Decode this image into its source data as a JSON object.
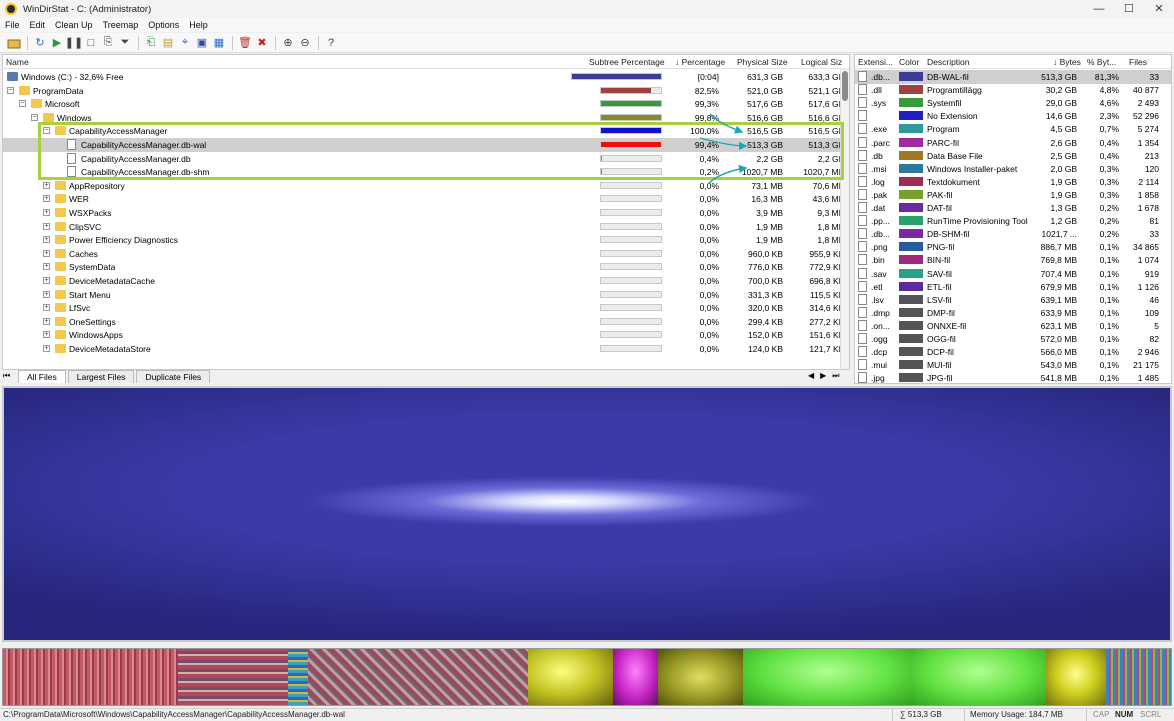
{
  "window": {
    "title": "WinDirStat - C: (Administrator)",
    "minimize": "—",
    "maximize": "☐",
    "close": "✕"
  },
  "menu": [
    "File",
    "Edit",
    "Clean Up",
    "Treemap",
    "Options",
    "Help"
  ],
  "tree": {
    "columns": {
      "name": "Name",
      "subtree": "Subtree Percentage",
      "percentage": "↓ Percentage",
      "physical": "Physical Size",
      "logical": "Logical Siz"
    },
    "rows": [
      {
        "name": "Windows (C:) - 32,6% Free",
        "level": 0,
        "kind": "drive",
        "exp": "",
        "bar": 1.0,
        "color": "#3b3b9c",
        "pct": "[0:04]",
        "phys": "631,3 GB",
        "log": "633,3 GI"
      },
      {
        "name": "ProgramData",
        "level": 0,
        "kind": "folder",
        "exp": "−",
        "bar": 0.825,
        "color": "#a04040",
        "pct": "82,5%",
        "phys": "521,0 GB",
        "log": "521,1 GI"
      },
      {
        "name": "Microsoft",
        "level": 1,
        "kind": "folder",
        "exp": "−",
        "bar": 0.993,
        "color": "#3a9a3a",
        "pct": "99,3%",
        "phys": "517,6 GB",
        "log": "517,6 GI"
      },
      {
        "name": "Windows",
        "level": 2,
        "kind": "folder",
        "exp": "−",
        "bar": 0.998,
        "color": "#8a8a2a",
        "pct": "99,8%",
        "phys": "516,6 GB",
        "log": "516,6 GI"
      },
      {
        "name": "CapabilityAccessManager",
        "level": 3,
        "kind": "folder",
        "exp": "−",
        "bar": 1.0,
        "color": "#1010d0",
        "pct": "100,0%",
        "phys": "516,5 GB",
        "log": "516,5 GI"
      },
      {
        "name": "CapabilityAccessManager.db-wal",
        "level": 4,
        "kind": "file",
        "exp": "",
        "bar": 0.994,
        "color": "#ee1010",
        "pct": "99,4%",
        "phys": "513,3 GB",
        "log": "513,3 GI",
        "selected": true
      },
      {
        "name": "CapabilityAccessManager.db",
        "level": 4,
        "kind": "file",
        "exp": "",
        "bar": 0.004,
        "color": "#888888",
        "pct": "0,4%",
        "phys": "2,2 GB",
        "log": "2,2 GI"
      },
      {
        "name": "CapabilityAccessManager.db-shm",
        "level": 4,
        "kind": "file",
        "exp": "",
        "bar": 0.002,
        "color": "#888888",
        "pct": "0,2%",
        "phys": "1020,7 MB",
        "log": "1020,7 MI"
      },
      {
        "name": "AppRepository",
        "level": 3,
        "kind": "folder",
        "exp": "+",
        "bar": 0.0,
        "color": "#888888",
        "pct": "0,0%",
        "phys": "73,1 MB",
        "log": "70,6 MI"
      },
      {
        "name": "WER",
        "level": 3,
        "kind": "folder",
        "exp": "+",
        "bar": 0.0,
        "color": "#888888",
        "pct": "0,0%",
        "phys": "16,3 MB",
        "log": "43,6 MI"
      },
      {
        "name": "WSXPacks",
        "level": 3,
        "kind": "folder",
        "exp": "+",
        "bar": 0.0,
        "color": "#888888",
        "pct": "0,0%",
        "phys": "3,9 MB",
        "log": "9,3 MI"
      },
      {
        "name": "ClipSVC",
        "level": 3,
        "kind": "folder",
        "exp": "+",
        "bar": 0.0,
        "color": "#888888",
        "pct": "0,0%",
        "phys": "1,9 MB",
        "log": "1,8 MI"
      },
      {
        "name": "Power Efficiency Diagnostics",
        "level": 3,
        "kind": "folder",
        "exp": "+",
        "bar": 0.0,
        "color": "#888888",
        "pct": "0,0%",
        "phys": "1,9 MB",
        "log": "1,8 MI"
      },
      {
        "name": "Caches",
        "level": 3,
        "kind": "folder",
        "exp": "+",
        "bar": 0.0,
        "color": "#888888",
        "pct": "0,0%",
        "phys": "960,0 KB",
        "log": "955,9 KI"
      },
      {
        "name": "SystemData",
        "level": 3,
        "kind": "folder",
        "exp": "+",
        "bar": 0.0,
        "color": "#888888",
        "pct": "0,0%",
        "phys": "776,0 KB",
        "log": "772,9 KI"
      },
      {
        "name": "DeviceMetadataCache",
        "level": 3,
        "kind": "folder",
        "exp": "+",
        "bar": 0.0,
        "color": "#888888",
        "pct": "0,0%",
        "phys": "700,0 KB",
        "log": "696,8 KI"
      },
      {
        "name": "Start Menu",
        "level": 3,
        "kind": "folder",
        "exp": "+",
        "bar": 0.0,
        "color": "#888888",
        "pct": "0,0%",
        "phys": "331,3 KB",
        "log": "115,5 KI"
      },
      {
        "name": "LfSvc",
        "level": 3,
        "kind": "folder",
        "exp": "+",
        "bar": 0.0,
        "color": "#888888",
        "pct": "0,0%",
        "phys": "320,0 KB",
        "log": "314,6 KI"
      },
      {
        "name": "OneSettings",
        "level": 3,
        "kind": "folder",
        "exp": "+",
        "bar": 0.0,
        "color": "#888888",
        "pct": "0,0%",
        "phys": "299,4 KB",
        "log": "277,2 KI"
      },
      {
        "name": "WindowsApps",
        "level": 3,
        "kind": "folder",
        "exp": "+",
        "bar": 0.0,
        "color": "#888888",
        "pct": "0,0%",
        "phys": "152,0 KB",
        "log": "151,6 KI"
      },
      {
        "name": "DeviceMetadataStore",
        "level": 3,
        "kind": "folder",
        "exp": "+",
        "bar": 0.0,
        "color": "#888888",
        "pct": "0,0%",
        "phys": "124,0 KB",
        "log": "121,7 KI"
      }
    ]
  },
  "tabs": [
    "All Files",
    "Largest Files",
    "Duplicate Files"
  ],
  "extensions": {
    "columns": {
      "ext": "Extensi...",
      "color": "Color",
      "desc": "Description",
      "bytes": "↓ Bytes",
      "pct": "% Byt...",
      "files": "Files"
    },
    "rows": [
      {
        "ext": ".db...",
        "color": "#3b3b9c",
        "desc": "DB-WAL-fil",
        "bytes": "513,3 GB",
        "pct": "81,3%",
        "files": "33",
        "selected": true
      },
      {
        "ext": ".dll",
        "color": "#a04040",
        "desc": "Programtillägg",
        "bytes": "30,2 GB",
        "pct": "4,8%",
        "files": "40 877"
      },
      {
        "ext": ".sys",
        "color": "#3a9a3a",
        "desc": "Systemfil",
        "bytes": "29,0 GB",
        "pct": "4,6%",
        "files": "2 493"
      },
      {
        "ext": "",
        "color": "#2020c0",
        "desc": "No Extension",
        "bytes": "14,6 GB",
        "pct": "2,3%",
        "files": "52 296"
      },
      {
        "ext": ".exe",
        "color": "#2a9a9a",
        "desc": "Program",
        "bytes": "4,5 GB",
        "pct": "0,7%",
        "files": "5 274"
      },
      {
        "ext": ".parc",
        "color": "#a02aa0",
        "desc": "PARC-fil",
        "bytes": "2,6 GB",
        "pct": "0,4%",
        "files": "1 354"
      },
      {
        "ext": ".db",
        "color": "#a07a20",
        "desc": "Data Base File",
        "bytes": "2,5 GB",
        "pct": "0,4%",
        "files": "213"
      },
      {
        "ext": ".msi",
        "color": "#2a7aa0",
        "desc": "Windows Installer-paket",
        "bytes": "2,0 GB",
        "pct": "0,3%",
        "files": "120"
      },
      {
        "ext": ".log",
        "color": "#a02a5a",
        "desc": "Textdokument",
        "bytes": "1,9 GB",
        "pct": "0,3%",
        "files": "2 114"
      },
      {
        "ext": ".pak",
        "color": "#7aa02a",
        "desc": "PAK-fil",
        "bytes": "1,9 GB",
        "pct": "0,3%",
        "files": "1 858"
      },
      {
        "ext": ".dat",
        "color": "#6a2aa0",
        "desc": "DAT-fil",
        "bytes": "1,3 GB",
        "pct": "0,2%",
        "files": "1 678"
      },
      {
        "ext": ".pp...",
        "color": "#2aa06a",
        "desc": "RunTime Provisioning Tool",
        "bytes": "1,2 GB",
        "pct": "0,2%",
        "files": "81"
      },
      {
        "ext": ".db...",
        "color": "#7a2aa0",
        "desc": "DB-SHM-fil",
        "bytes": "1021,7 ...",
        "pct": "0,2%",
        "files": "33"
      },
      {
        "ext": ".png",
        "color": "#2a5aa0",
        "desc": "PNG-fil",
        "bytes": "886,7 MB",
        "pct": "0,1%",
        "files": "34 865"
      },
      {
        "ext": ".bin",
        "color": "#a02a7a",
        "desc": "BIN-fil",
        "bytes": "769,8 MB",
        "pct": "0,1%",
        "files": "1 074"
      },
      {
        "ext": ".sav",
        "color": "#2aa08a",
        "desc": "SAV-fil",
        "bytes": "707,4 MB",
        "pct": "0,1%",
        "files": "919"
      },
      {
        "ext": ".etl",
        "color": "#5a2aa0",
        "desc": "ETL-fil",
        "bytes": "679,9 MB",
        "pct": "0,1%",
        "files": "1 126"
      },
      {
        "ext": ".lsv",
        "color": "#555555",
        "desc": "LSV-fil",
        "bytes": "639,1 MB",
        "pct": "0,1%",
        "files": "46"
      },
      {
        "ext": ".dmp",
        "color": "#555555",
        "desc": "DMP-fil",
        "bytes": "633,9 MB",
        "pct": "0,1%",
        "files": "109"
      },
      {
        "ext": ".on...",
        "color": "#555555",
        "desc": "ONNXE-fil",
        "bytes": "623,1 MB",
        "pct": "0,1%",
        "files": "5"
      },
      {
        "ext": ".ogg",
        "color": "#555555",
        "desc": "OGG-fil",
        "bytes": "572,0 MB",
        "pct": "0,1%",
        "files": "82"
      },
      {
        "ext": ".dcp",
        "color": "#555555",
        "desc": "DCP-fil",
        "bytes": "566,0 MB",
        "pct": "0,1%",
        "files": "2 946"
      },
      {
        "ext": ".mui",
        "color": "#555555",
        "desc": "MUI-fil",
        "bytes": "543,0 MB",
        "pct": "0,1%",
        "files": "21 175"
      },
      {
        "ext": ".jpg",
        "color": "#555555",
        "desc": "JPG-fil",
        "bytes": "541,8 MB",
        "pct": "0,1%",
        "files": "1 485"
      }
    ]
  },
  "status": {
    "path": "C:\\ProgramData\\Microsoft\\Windows\\CapabilityAccessManager\\CapabilityAccessManager.db-wal",
    "sum": "∑ 513,3 GB",
    "memory": "Memory Usage: 184,7 MB",
    "cap": "CAP",
    "num": "NUM",
    "scrl": "SCRL"
  },
  "colors": {
    "highlight": "#a6d13a",
    "arrow": "#19a9b4",
    "selection": "#cfcfcf"
  }
}
